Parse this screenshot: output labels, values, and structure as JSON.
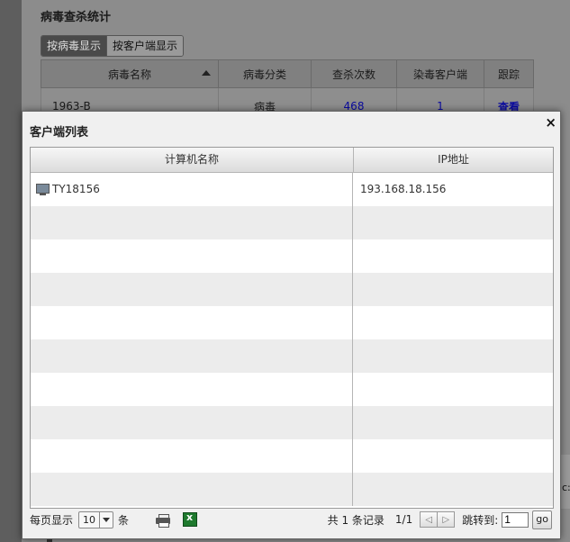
{
  "background": {
    "title": "病毒查杀统计",
    "tabs": [
      "按病毒显示",
      "按客户端显示"
    ],
    "table": {
      "headers": [
        "病毒名称",
        "病毒分类",
        "查杀次数",
        "染毒客户端",
        "跟踪"
      ],
      "rows": [
        {
          "name": "_1963-B",
          "category": "病毒",
          "kills": "468",
          "clients": "1",
          "track": "查看"
        }
      ]
    },
    "side_text": "c:"
  },
  "dialog": {
    "title": "客户端列表",
    "close_label": "×",
    "columns": [
      "计算机名称",
      "IP地址"
    ],
    "rows": [
      {
        "computer": "TY18156",
        "ip": "193.168.18.156"
      }
    ],
    "empty_rows": 9
  },
  "pager": {
    "per_page_label": "每页显示",
    "per_page_value": "10",
    "per_page_unit": "条",
    "total_text": "共 1 条记录",
    "page_text": "1/1",
    "prev_label": "◁",
    "next_label": "▷",
    "jump_label": "跳转到:",
    "jump_value": "1",
    "go_label": "go"
  },
  "icons": {
    "computer": "computer-icon",
    "print": "printer-icon",
    "export": "excel-export-icon",
    "sort": "sort-up-icon"
  }
}
